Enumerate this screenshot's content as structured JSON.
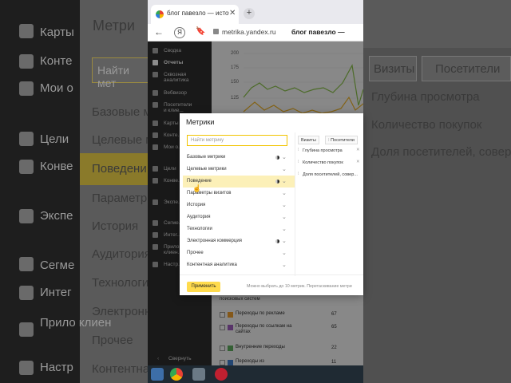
{
  "browser": {
    "tab_title": "блог павезло — источ",
    "url": "metrika.yandex.ru",
    "page_title": "блог павезло —",
    "yandex_badge": "Я"
  },
  "sidebar": {
    "items": [
      {
        "label": "Сводка"
      },
      {
        "label": "Отчеты",
        "active": true
      },
      {
        "label": "Сквозная\nаналитика"
      },
      {
        "label": "Вебвизор"
      },
      {
        "label": "Посетители\nи клие..."
      },
      {
        "label": "Карты"
      },
      {
        "label": "Конте..."
      },
      {
        "label": "Мои о..."
      },
      {
        "label": "Цели"
      },
      {
        "label": "Конве..."
      },
      {
        "label": "Экспе..."
      },
      {
        "label": "Сегме..."
      },
      {
        "label": "Интег..."
      },
      {
        "label": "Прило\nклиен..."
      },
      {
        "label": "Настр..."
      }
    ],
    "collapse_label": "Свернуть"
  },
  "chart": {
    "y_ticks": [
      "200",
      "175",
      "150",
      "125"
    ],
    "colors": {
      "green": "#8bc34a",
      "orange": "#f0b429"
    }
  },
  "table_rows": [
    {
      "label": "поисковых систем",
      "value": ""
    },
    {
      "label": "Переходы по рекламе",
      "value": "67",
      "color": "#f0a030"
    },
    {
      "label": "Переходы по ссылкам на сайтах",
      "value": "65",
      "color": "#a060c0"
    },
    {
      "label": "Внутренние переходы",
      "value": "22",
      "color": "#60b060"
    },
    {
      "label": "Переходы из",
      "value": "11",
      "color": "#4080d0"
    }
  ],
  "modal": {
    "title": "Метрики",
    "search_placeholder": "Найти метрику",
    "categories": [
      {
        "label": "Базовые метрики",
        "has_dot": true
      },
      {
        "label": "Целевые метрики"
      },
      {
        "label": "Поведение",
        "has_dot": true,
        "selected": true
      },
      {
        "label": "Параметры визитов"
      },
      {
        "label": "История"
      },
      {
        "label": "Аудитория"
      },
      {
        "label": "Технологии"
      },
      {
        "label": "Электронная коммерция",
        "has_dot": true
      },
      {
        "label": "Прочее"
      },
      {
        "label": "Контентная аналитика"
      }
    ],
    "chips": [
      "Визиты",
      "Посетители"
    ],
    "selected_metrics": [
      "Глубина просмотра",
      "Количество покупок",
      "Доля посетителей, совер..."
    ],
    "apply_label": "Применить",
    "hint": "Можно выбрать до 10 метрик. Перетаскивание метри"
  },
  "background": {
    "left_labels": [
      "Карты",
      "Конте",
      "Мои о",
      "Цели",
      "Конве",
      "Экспе",
      "Сегме",
      "Интег",
      "Прило клиен",
      "Настр"
    ],
    "title": "Метри",
    "search": "Найти мет",
    "categories": [
      "Базовые м",
      "Целевые м",
      "Поведени",
      "Параметры",
      "История",
      "Аудитория",
      "Технологи",
      "Электронн",
      "Прочее",
      "Контентна"
    ],
    "right_items": [
      "Визиты",
      "Посетители",
      "Глубина просмотра",
      "Количество покупок",
      "Доля посетителей, совер..."
    ]
  },
  "taskbar_icons": [
    "desktop-icon",
    "chrome-icon",
    "calculator-icon",
    "app-icon"
  ]
}
